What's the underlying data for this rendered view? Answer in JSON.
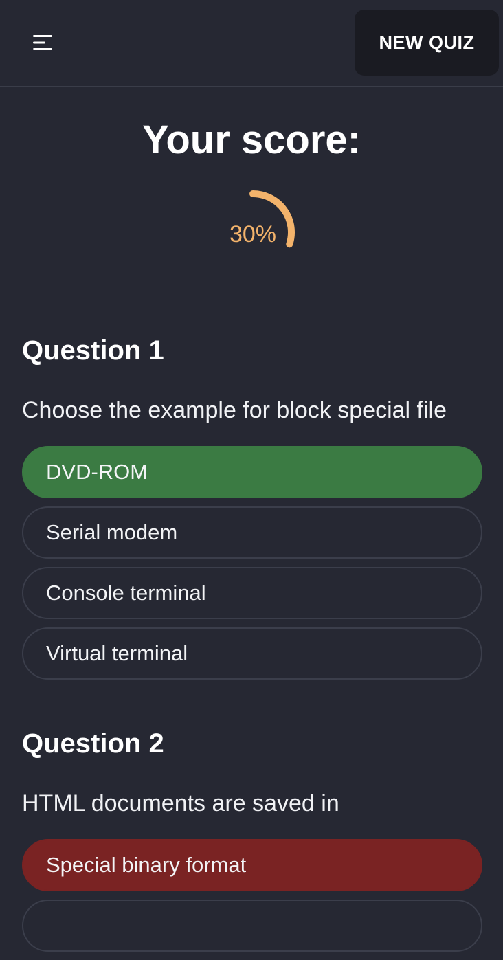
{
  "header": {
    "new_quiz_label": "NEW QUIZ"
  },
  "score": {
    "title": "Your score:",
    "value_text": "30%",
    "percent": 30,
    "color": "#f3b36b"
  },
  "questions": [
    {
      "heading": "Question 1",
      "text": "Choose the example for block special file",
      "options": [
        {
          "label": "DVD-ROM",
          "state": "correct"
        },
        {
          "label": "Serial modem",
          "state": "none"
        },
        {
          "label": "Console terminal",
          "state": "none"
        },
        {
          "label": "Virtual terminal",
          "state": "none"
        }
      ]
    },
    {
      "heading": "Question 2",
      "text": "HTML documents are saved in",
      "options": [
        {
          "label": "Special binary format",
          "state": "wrong"
        }
      ]
    }
  ],
  "colors": {
    "correct": "#3b7b43",
    "wrong": "#7a2323",
    "background": "#262833"
  }
}
